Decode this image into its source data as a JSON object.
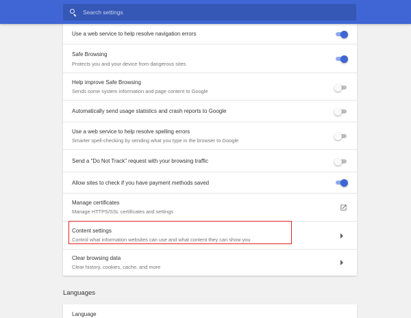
{
  "search": {
    "placeholder": "Search settings",
    "icon": "search-icon"
  },
  "accent_color": "#3f66d4",
  "highlight_color": "#e0201c",
  "settings": [
    {
      "title": "Use a web service to help resolve navigation errors",
      "subtitle": "",
      "control": "toggle",
      "on": true
    },
    {
      "title": "Safe Browsing",
      "subtitle": "Protects you and your device from dangerous sites",
      "control": "toggle",
      "on": true
    },
    {
      "title": "Help improve Safe Browsing",
      "subtitle": "Sends some system information and page content to Google",
      "control": "toggle",
      "on": false
    },
    {
      "title": "Automatically send usage statistics and crash reports to Google",
      "subtitle": "",
      "control": "toggle",
      "on": false
    },
    {
      "title": "Use a web service to help resolve spelling errors",
      "subtitle": "Smarter spell-checking by sending what you type in the browser to Google",
      "control": "toggle",
      "on": false
    },
    {
      "title": "Send a \"Do Not Track\" request with your browsing traffic",
      "subtitle": "",
      "control": "toggle",
      "on": false
    },
    {
      "title": "Allow sites to check if you have payment methods saved",
      "subtitle": "",
      "control": "toggle",
      "on": true
    },
    {
      "title": "Manage certificates",
      "subtitle": "Manage HTTPS/SSL certificates and settings",
      "control": "launch-icon"
    },
    {
      "title": "Content settings",
      "subtitle": "Control what information websites can use and what content they can show you",
      "control": "arrow-right-icon",
      "highlighted": true
    },
    {
      "title": "Clear browsing data",
      "subtitle": "Clear history, cookies, cache, and more",
      "control": "arrow-right-icon"
    }
  ],
  "languages": {
    "section_title": "Languages",
    "first_item": "Language"
  }
}
